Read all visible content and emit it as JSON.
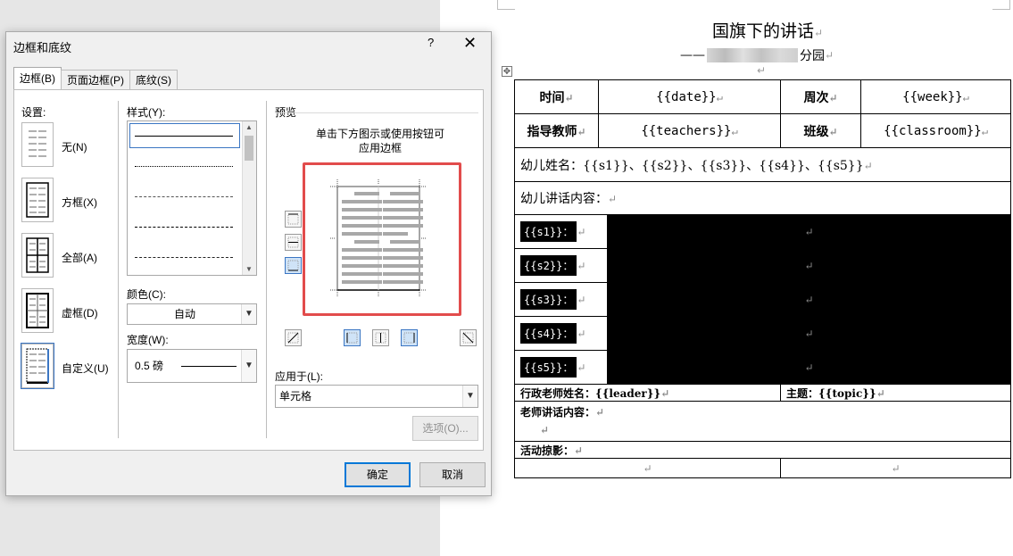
{
  "document": {
    "title": "国旗下的讲话",
    "subtitle_dash": "——",
    "subtitle_suffix": "分园",
    "para_mark": "↵",
    "time_label": "时间",
    "time_value": "{{date}}",
    "week_label": "周次",
    "week_value": "{{week}}",
    "teacher_label": "指导教师",
    "teacher_value": "{{teachers}}",
    "class_label": "班级",
    "class_value": "{{classroom}}",
    "children_names": "幼儿姓名：{{s1}}、{{s2}}、{{s3}}、{{s4}}、{{s5}}",
    "children_speech_label": "幼儿讲话内容：",
    "speech_rows": [
      "{{s1}}：",
      "{{s2}}：",
      "{{s3}}：",
      "{{s4}}：",
      "{{s5}}："
    ],
    "leader_label": "行政老师姓名：{{leader}}",
    "topic_label": "主题：{{topic}}",
    "teacher_speech_label": "老师讲话内容：",
    "activity_label": "活动掠影："
  },
  "dialog": {
    "title": "边框和底纹",
    "help": "?",
    "close": "✕",
    "tabs": [
      "边框(B)",
      "页面边框(P)",
      "底纹(S)"
    ],
    "settings_label": "设置:",
    "settings": [
      "无(N)",
      "方框(X)",
      "全部(A)",
      "虚框(D)",
      "自定义(U)"
    ],
    "settings_selected": "自定义(U)",
    "style_label": "样式(Y):",
    "color_label": "颜色(C):",
    "color_value": "自动",
    "width_label": "宽度(W):",
    "width_value": "0.5 磅",
    "preview_label": "预览",
    "preview_hint_line1": "单击下方图示或使用按钮可",
    "preview_hint_line2": "应用边框",
    "apply_label": "应用于(L):",
    "apply_value": "单元格",
    "options_button": "选项(O)...",
    "ok_button": "确定",
    "cancel_button": "取消"
  },
  "colors": {
    "accent_blue": "#0078d7",
    "highlight_red": "#e24c4c",
    "cell_black": "#000000"
  }
}
